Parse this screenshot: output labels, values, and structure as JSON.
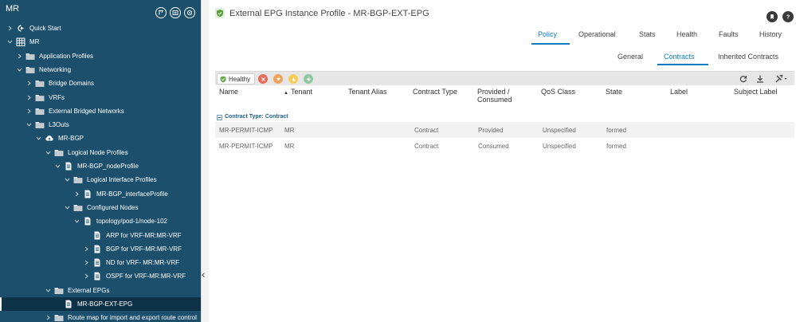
{
  "sidebar": {
    "title": "MR",
    "tree": [
      {
        "label": "Quick Start"
      },
      {
        "label": "MR"
      },
      {
        "label": "Application Profiles"
      },
      {
        "label": "Networking"
      },
      {
        "label": "Bridge Domains"
      },
      {
        "label": "VRFs"
      },
      {
        "label": "External Bridged Networks"
      },
      {
        "label": "L3Outs"
      },
      {
        "label": "MR-BGP"
      },
      {
        "label": "Logical Node Profiles"
      },
      {
        "label": "MR-BGP_nodeProfile"
      },
      {
        "label": "Logical Interface Profiles"
      },
      {
        "label": "MR-BGP_interfaceProfile"
      },
      {
        "label": "Configured Nodes"
      },
      {
        "label": "topology/pod-1/node-102"
      },
      {
        "label": "ARP for VRF-MR:MR-VRF"
      },
      {
        "label": "BGP for VRF-MR:MR-VRF"
      },
      {
        "label": "ND for VRF- MR:MR-VRF"
      },
      {
        "label": "OSPF for VRF-MR:MR-VRF"
      },
      {
        "label": "External EPGs"
      },
      {
        "label": "MR-BGP-EXT-EPG"
      },
      {
        "label": "Route map for import and export route control"
      }
    ]
  },
  "main": {
    "title": "External EPG Instance Profile - MR-BGP-EXT-EPG",
    "tabs": [
      "Policy",
      "Operational",
      "Stats",
      "Health",
      "Faults",
      "History"
    ],
    "active_tab": "Policy",
    "subtabs": [
      "General",
      "Contracts",
      "Inherited Contracts"
    ],
    "active_subtab": "Contracts",
    "health_label": "Healthy",
    "colors": {
      "accent": "#0a7bc0",
      "sidebar_bg": "#1c4f6b",
      "healthy_green": "#6aa84f",
      "critical": "#e26d5c",
      "major": "#f0a35a",
      "minor": "#f4cd59",
      "warning": "#8fc9a2"
    },
    "table": {
      "columns": [
        "Name",
        "Tenant",
        "Tenant Alias",
        "Contract Type",
        "Provided / Consumed",
        "QoS Class",
        "State",
        "Label",
        "Subject Label"
      ],
      "group_label": "Contract Type: Contract",
      "rows": [
        [
          "MR-PERMIT-ICMP",
          "MR",
          "",
          "Contract",
          "Provided",
          "Unspecified",
          "formed",
          "",
          ""
        ],
        [
          "MR-PERMIT-ICMP",
          "MR",
          "",
          "Contract",
          "Consumed",
          "Unspecified",
          "formed",
          "",
          ""
        ]
      ]
    }
  }
}
